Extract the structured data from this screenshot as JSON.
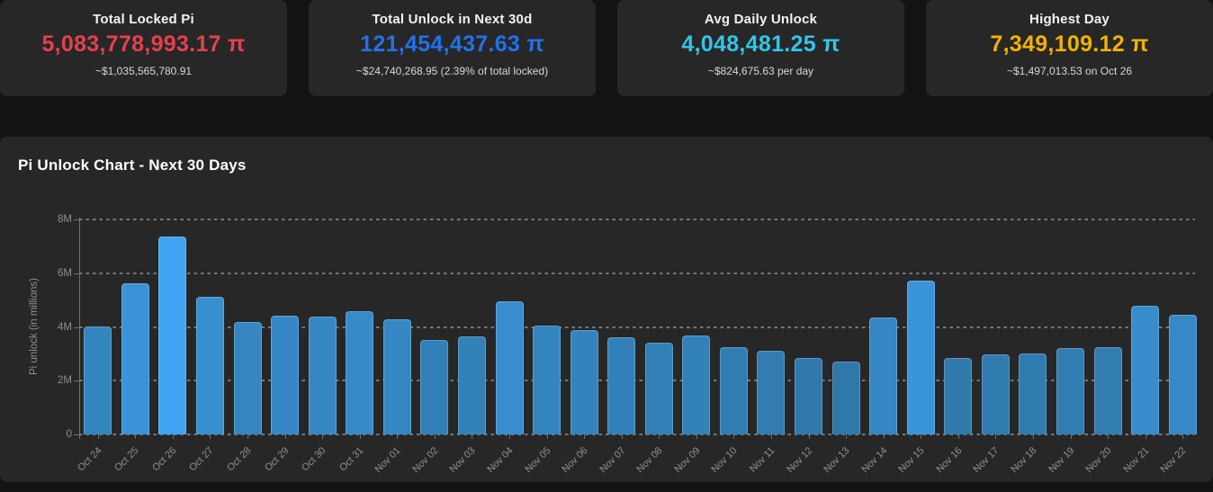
{
  "stat_cards": [
    {
      "title": "Total Locked Pi",
      "value": "5,083,778,993.17 π",
      "subtitle": "~$1,035,565,780.91",
      "color": "#e5404e"
    },
    {
      "title": "Total Unlock in Next 30d",
      "value": "121,454,437.63 π",
      "subtitle": "~$24,740,268.95 (2.39% of total locked)",
      "color": "#2171ee"
    },
    {
      "title": "Avg Daily Unlock",
      "value": "4,048,481.25 π",
      "subtitle": "~$824,675.63 per day",
      "color": "#31c6e8"
    },
    {
      "title": "Highest Day",
      "value": "7,349,109.12 π",
      "subtitle": "~$1,497,013.53 on Oct 26",
      "color": "#f2b200"
    }
  ],
  "chart_data": {
    "type": "bar",
    "title": "Pi Unlock Chart - Next 30 Days",
    "ylabel": "Pi unlock (in millions)",
    "unit": "millions of Pi",
    "categories": [
      "Oct 24",
      "Oct 25",
      "Oct 26",
      "Oct 27",
      "Oct 28",
      "Oct 29",
      "Oct 30",
      "Oct 31",
      "Nov 01",
      "Nov 02",
      "Nov 03",
      "Nov 04",
      "Nov 05",
      "Nov 06",
      "Nov 07",
      "Nov 08",
      "Nov 09",
      "Nov 10",
      "Nov 11",
      "Nov 12",
      "Nov 13",
      "Nov 14",
      "Nov 15",
      "Nov 16",
      "Nov 17",
      "Nov 18",
      "Nov 19",
      "Nov 20",
      "Nov 21",
      "Nov 22"
    ],
    "values": [
      4.0,
      5.62,
      7.35,
      5.12,
      4.17,
      4.41,
      4.37,
      4.58,
      4.28,
      3.53,
      3.66,
      4.95,
      4.06,
      3.89,
      3.61,
      3.41,
      3.69,
      3.24,
      3.1,
      2.85,
      2.71,
      4.35,
      5.72,
      2.85,
      2.99,
      3.02,
      3.22,
      3.24,
      4.8,
      4.44
    ],
    "ylim": [
      0,
      8
    ],
    "ytick_values": [
      0,
      2,
      4,
      6,
      8
    ],
    "ytick_labels": [
      "0",
      "2M",
      "4M",
      "6M",
      "8M"
    ],
    "grid": "horizontal-dashed",
    "legend": "none",
    "bar_color_low": "#2f77a8",
    "bar_color_high": "#40a4f5",
    "bar_color_rule": "interpolated by value between bar_color_low (≈2.6M) and bar_color_high (≈7.4M)"
  }
}
